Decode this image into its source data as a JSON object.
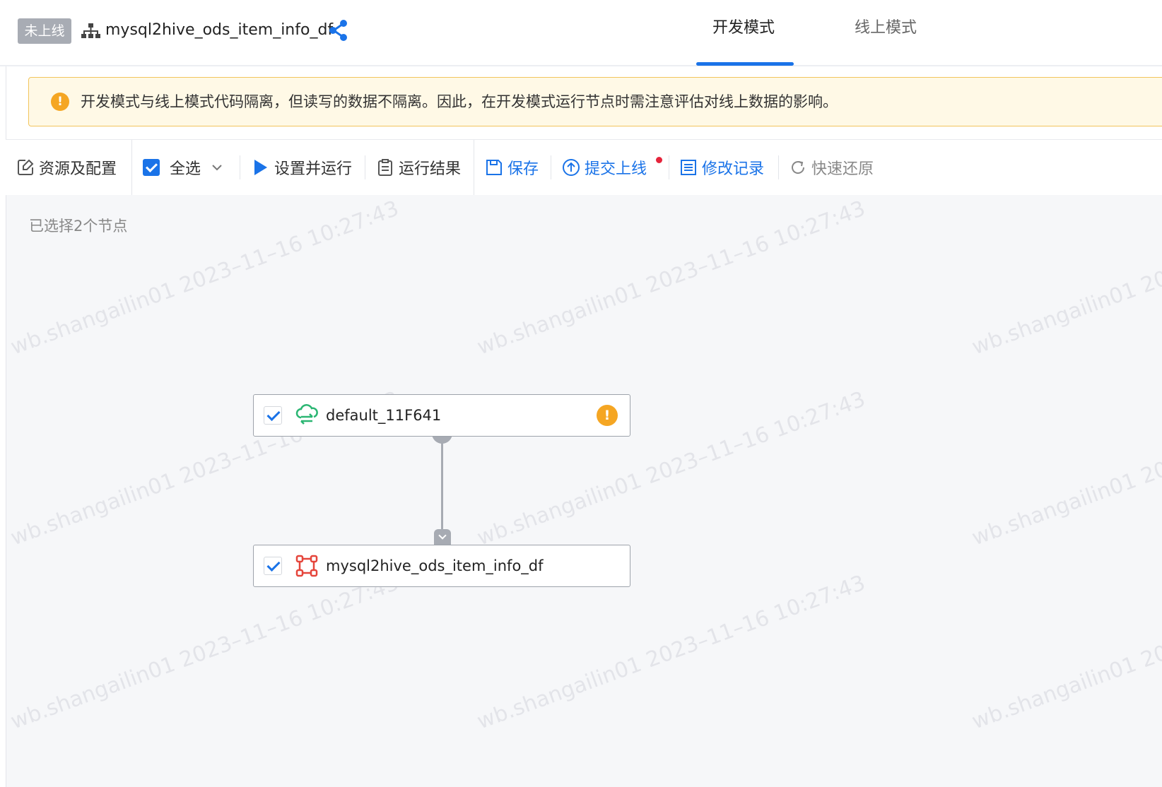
{
  "header": {
    "status_tag": "未上线",
    "task_name": "mysql2hive_ods_item_info_df",
    "tabs": [
      {
        "label": "开发模式",
        "active": true
      },
      {
        "label": "线上模式",
        "active": false
      }
    ]
  },
  "notice": {
    "icon": "warning-icon",
    "text": "开发模式与线上模式代码隔离，但读写的数据不隔离。因此，在开发模式运行节点时需注意评估对线上数据的影响。"
  },
  "toolbar": {
    "resources": "资源及配置",
    "select_all": "全选",
    "set_and_run": "设置并运行",
    "run_results": "运行结果",
    "save": "保存",
    "submit_online": "提交上线",
    "change_log": "修改记录",
    "quick_restore": "快速还原"
  },
  "canvas": {
    "selected_count": "已选择2个节点",
    "nodes": [
      {
        "label": "default_11F641",
        "icon": "cloud-sync-icon",
        "checked": true,
        "has_warning": true
      },
      {
        "label": "mysql2hive_ods_item_info_df",
        "icon": "sync-node-icon",
        "checked": true,
        "has_warning": false
      }
    ],
    "watermark": "wb.shangailin01 2023–11–16 10:27:43"
  },
  "colors": {
    "accent": "#1a73e8",
    "warning": "#f5a623",
    "cloud_icon": "#2bb673",
    "node_icon": "#e5453b",
    "status_tag_bg": "#a8acb4"
  }
}
